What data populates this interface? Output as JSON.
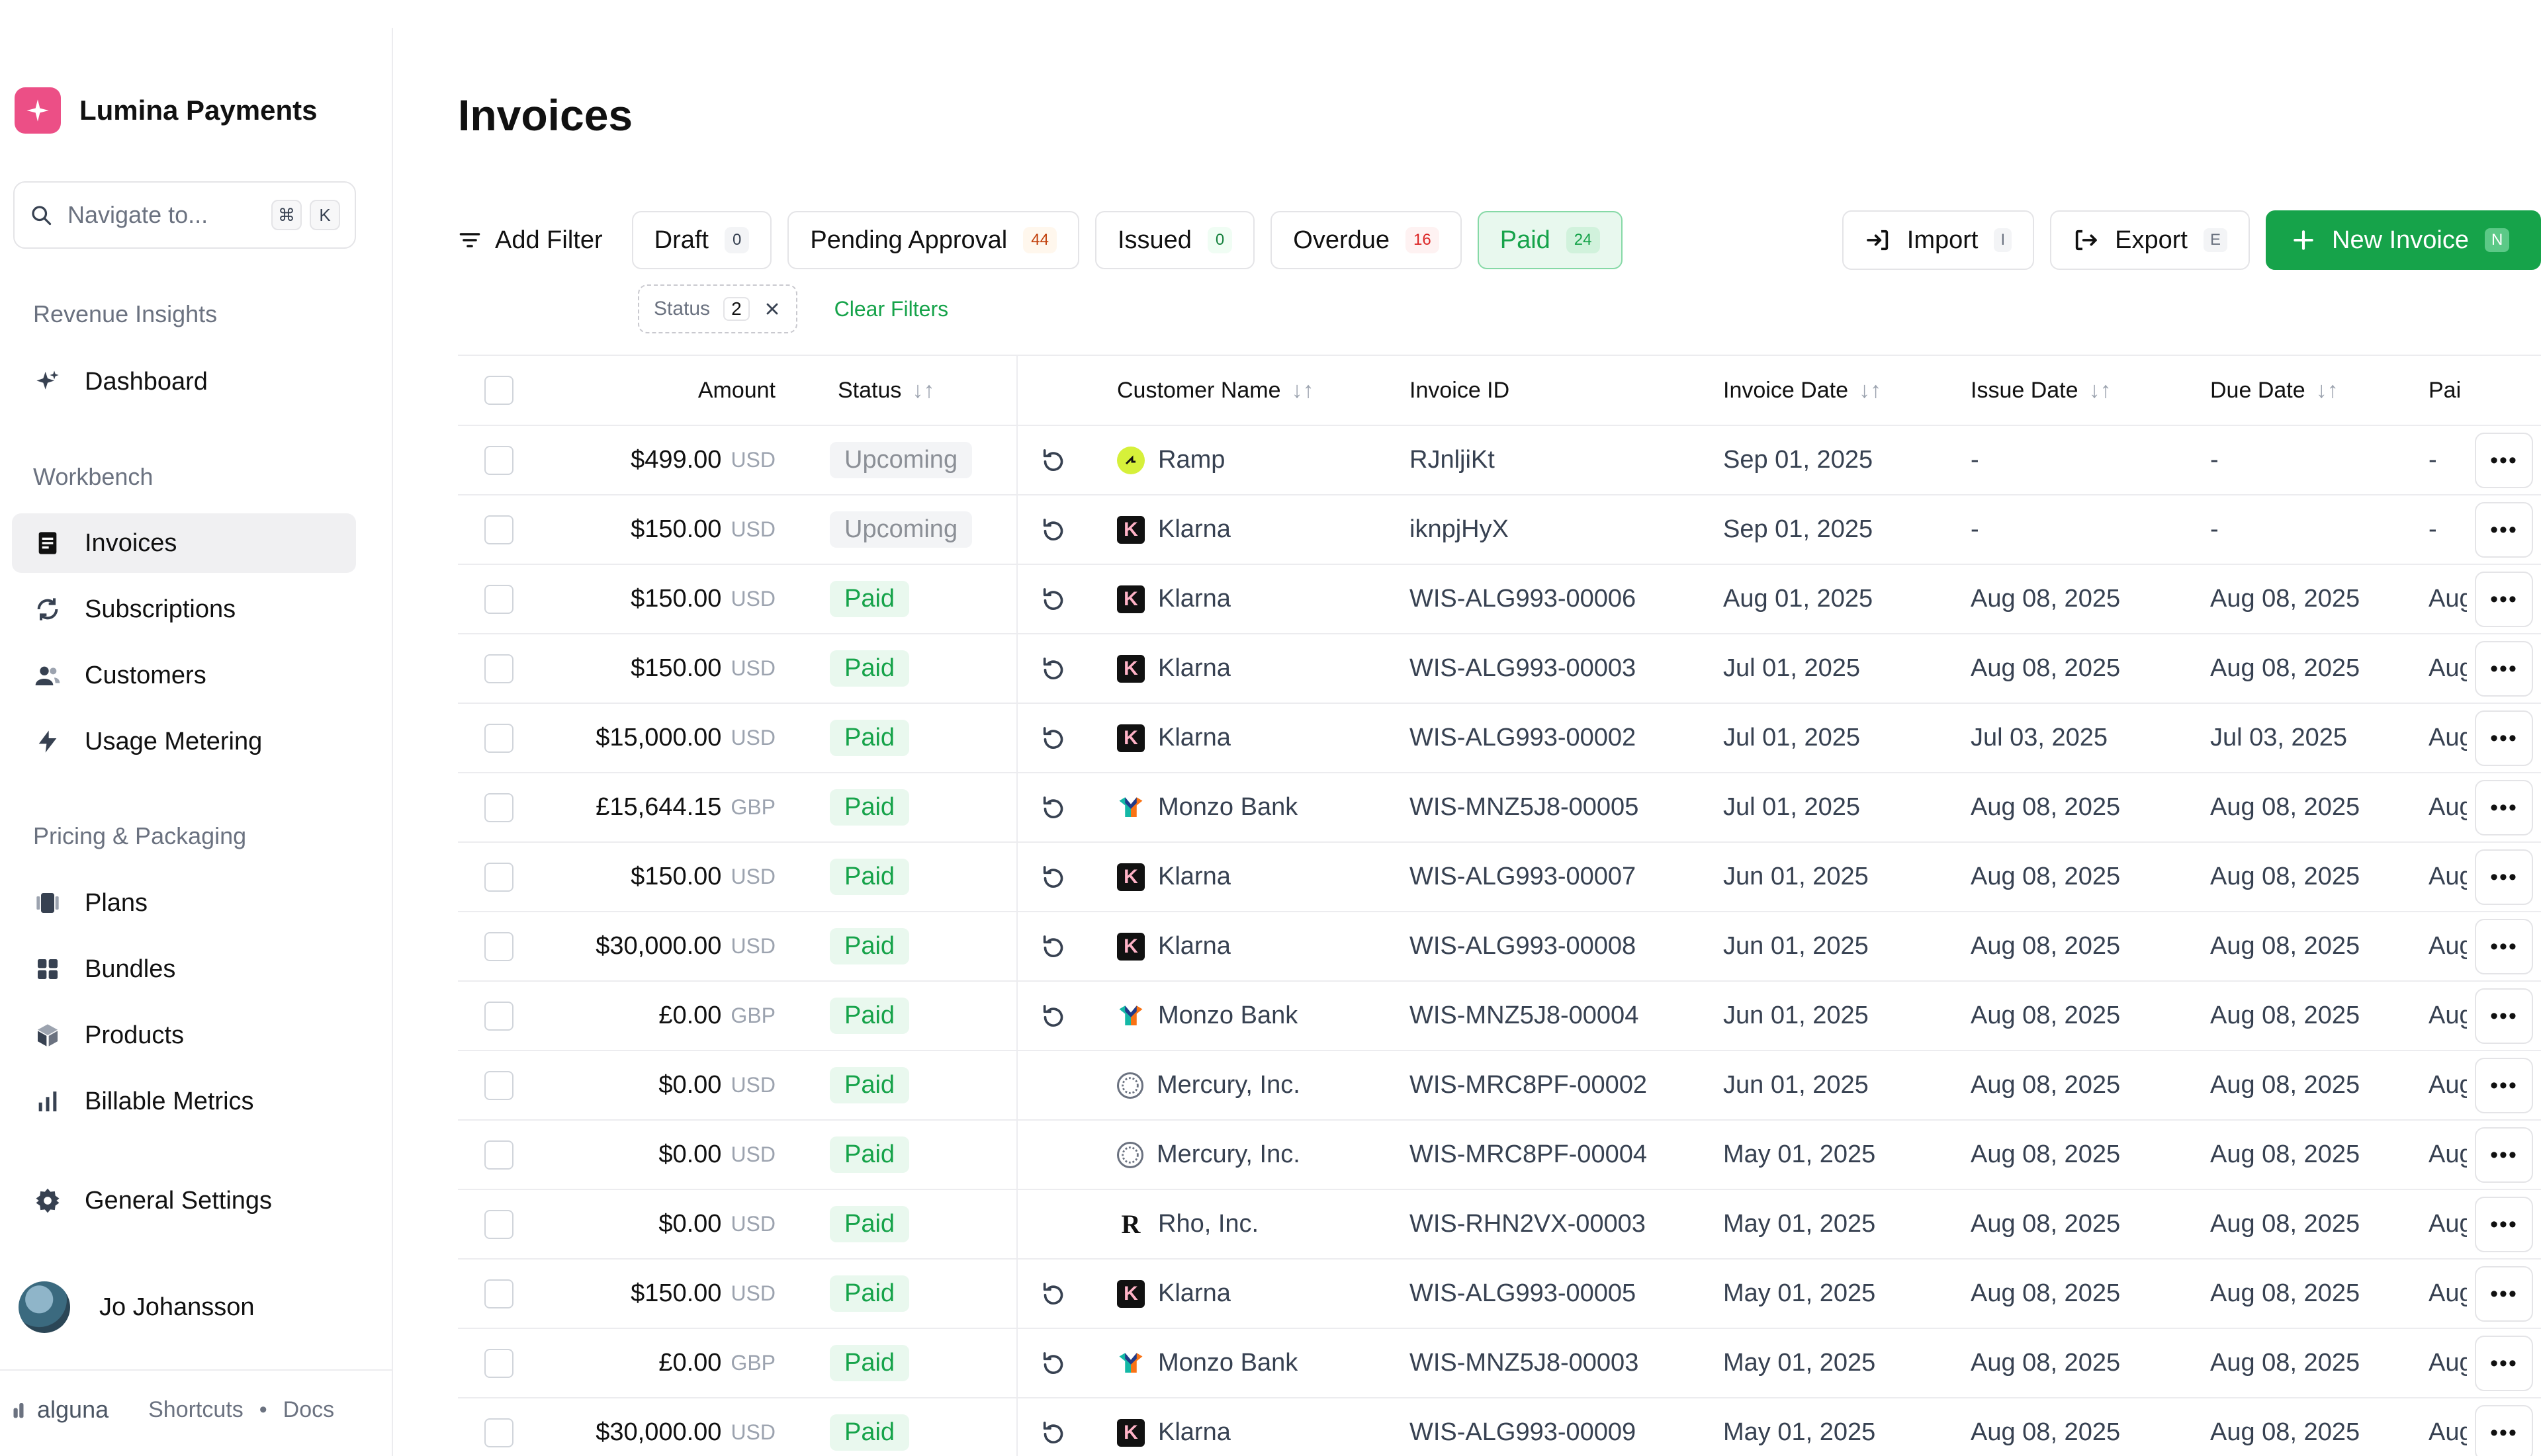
{
  "sidebar": {
    "brand": "Lumina Payments",
    "search_placeholder": "Navigate to...",
    "search_keys": [
      "⌘",
      "K"
    ],
    "sections": {
      "revenue": "Revenue Insights",
      "workbench": "Workbench",
      "pricing": "Pricing & Packaging"
    },
    "items": {
      "dashboard": "Dashboard",
      "invoices": "Invoices",
      "subscriptions": "Subscriptions",
      "customers": "Customers",
      "usage": "Usage Metering",
      "plans": "Plans",
      "bundles": "Bundles",
      "products": "Products",
      "metrics": "Billable Metrics",
      "settings": "General Settings"
    },
    "user_name": "Jo Johansson",
    "footer": {
      "logo": "alguna",
      "shortcuts": "Shortcuts",
      "dot": "•",
      "docs": "Docs"
    }
  },
  "page_title": "Invoices",
  "toolbar": {
    "add_filter": "Add Filter",
    "chips": [
      {
        "label": "Draft",
        "count": "0"
      },
      {
        "label": "Pending Approval",
        "count": "44"
      },
      {
        "label": "Issued",
        "count": "0"
      },
      {
        "label": "Overdue",
        "count": "16"
      },
      {
        "label": "Paid",
        "count": "24"
      }
    ],
    "import": {
      "label": "Import",
      "key": "I"
    },
    "export": {
      "label": "Export",
      "key": "E"
    },
    "new_invoice": {
      "label": "New Invoice",
      "key": "N"
    }
  },
  "active_filter": {
    "label": "Status",
    "count": "2",
    "clear": "Clear Filters"
  },
  "columns": {
    "amount": "Amount",
    "status": "Status",
    "customer": "Customer Name",
    "invoice_id": "Invoice ID",
    "invoice_date": "Invoice Date",
    "issue_date": "Issue Date",
    "due_date": "Due Date",
    "paid": "Pai"
  },
  "rows": [
    {
      "amount": "$499.00",
      "cur": "USD",
      "status": "Upcoming",
      "recurring": true,
      "customer": "Ramp",
      "logo": "ramp",
      "id": "RJnljiKt",
      "inv": "Sep 01, 2025",
      "issue": "-",
      "due": "-",
      "paid": "-"
    },
    {
      "amount": "$150.00",
      "cur": "USD",
      "status": "Upcoming",
      "recurring": true,
      "customer": "Klarna",
      "logo": "klarna",
      "id": "iknpjHyX",
      "inv": "Sep 01, 2025",
      "issue": "-",
      "due": "-",
      "paid": "-"
    },
    {
      "amount": "$150.00",
      "cur": "USD",
      "status": "Paid",
      "recurring": true,
      "customer": "Klarna",
      "logo": "klarna",
      "id": "WIS-ALG993-00006",
      "inv": "Aug 01, 2025",
      "issue": "Aug 08, 2025",
      "due": "Aug 08, 2025",
      "paid": "Aug"
    },
    {
      "amount": "$150.00",
      "cur": "USD",
      "status": "Paid",
      "recurring": true,
      "customer": "Klarna",
      "logo": "klarna",
      "id": "WIS-ALG993-00003",
      "inv": "Jul 01, 2025",
      "issue": "Aug 08, 2025",
      "due": "Aug 08, 2025",
      "paid": "Aug"
    },
    {
      "amount": "$15,000.00",
      "cur": "USD",
      "status": "Paid",
      "recurring": true,
      "customer": "Klarna",
      "logo": "klarna",
      "id": "WIS-ALG993-00002",
      "inv": "Jul 01, 2025",
      "issue": "Jul 03, 2025",
      "due": "Jul 03, 2025",
      "paid": "Aug"
    },
    {
      "amount": "£15,644.15",
      "cur": "GBP",
      "status": "Paid",
      "recurring": true,
      "customer": "Monzo Bank",
      "logo": "monzo",
      "id": "WIS-MNZ5J8-00005",
      "inv": "Jul 01, 2025",
      "issue": "Aug 08, 2025",
      "due": "Aug 08, 2025",
      "paid": "Aug"
    },
    {
      "amount": "$150.00",
      "cur": "USD",
      "status": "Paid",
      "recurring": true,
      "customer": "Klarna",
      "logo": "klarna",
      "id": "WIS-ALG993-00007",
      "inv": "Jun 01, 2025",
      "issue": "Aug 08, 2025",
      "due": "Aug 08, 2025",
      "paid": "Aug"
    },
    {
      "amount": "$30,000.00",
      "cur": "USD",
      "status": "Paid",
      "recurring": true,
      "customer": "Klarna",
      "logo": "klarna",
      "id": "WIS-ALG993-00008",
      "inv": "Jun 01, 2025",
      "issue": "Aug 08, 2025",
      "due": "Aug 08, 2025",
      "paid": "Aug"
    },
    {
      "amount": "£0.00",
      "cur": "GBP",
      "status": "Paid",
      "recurring": true,
      "customer": "Monzo Bank",
      "logo": "monzo",
      "id": "WIS-MNZ5J8-00004",
      "inv": "Jun 01, 2025",
      "issue": "Aug 08, 2025",
      "due": "Aug 08, 2025",
      "paid": "Aug"
    },
    {
      "amount": "$0.00",
      "cur": "USD",
      "status": "Paid",
      "recurring": false,
      "customer": "Mercury, Inc.",
      "logo": "mercury",
      "id": "WIS-MRC8PF-00002",
      "inv": "Jun 01, 2025",
      "issue": "Aug 08, 2025",
      "due": "Aug 08, 2025",
      "paid": "Aug"
    },
    {
      "amount": "$0.00",
      "cur": "USD",
      "status": "Paid",
      "recurring": false,
      "customer": "Mercury, Inc.",
      "logo": "mercury",
      "id": "WIS-MRC8PF-00004",
      "inv": "May 01, 2025",
      "issue": "Aug 08, 2025",
      "due": "Aug 08, 2025",
      "paid": "Aug"
    },
    {
      "amount": "$0.00",
      "cur": "USD",
      "status": "Paid",
      "recurring": false,
      "customer": "Rho, Inc.",
      "logo": "rho",
      "id": "WIS-RHN2VX-00003",
      "inv": "May 01, 2025",
      "issue": "Aug 08, 2025",
      "due": "Aug 08, 2025",
      "paid": "Aug"
    },
    {
      "amount": "$150.00",
      "cur": "USD",
      "status": "Paid",
      "recurring": true,
      "customer": "Klarna",
      "logo": "klarna",
      "id": "WIS-ALG993-00005",
      "inv": "May 01, 2025",
      "issue": "Aug 08, 2025",
      "due": "Aug 08, 2025",
      "paid": "Aug"
    },
    {
      "amount": "£0.00",
      "cur": "GBP",
      "status": "Paid",
      "recurring": true,
      "customer": "Monzo Bank",
      "logo": "monzo",
      "id": "WIS-MNZ5J8-00003",
      "inv": "May 01, 2025",
      "issue": "Aug 08, 2025",
      "due": "Aug 08, 2025",
      "paid": "Aug"
    },
    {
      "amount": "$30,000.00",
      "cur": "USD",
      "status": "Paid",
      "recurring": true,
      "customer": "Klarna",
      "logo": "klarna",
      "id": "WIS-ALG993-00009",
      "inv": "May 01, 2025",
      "issue": "Aug 08, 2025",
      "due": "Aug 08, 2025",
      "paid": "Aug"
    }
  ],
  "colors": {
    "accent": "#16a34a",
    "brand": "#ec4f86"
  },
  "icons": {
    "recurring": "refresh-icon",
    "row_menu": "more-horizontal-icon",
    "klarna_letter": "K",
    "rho_letter": "R"
  }
}
